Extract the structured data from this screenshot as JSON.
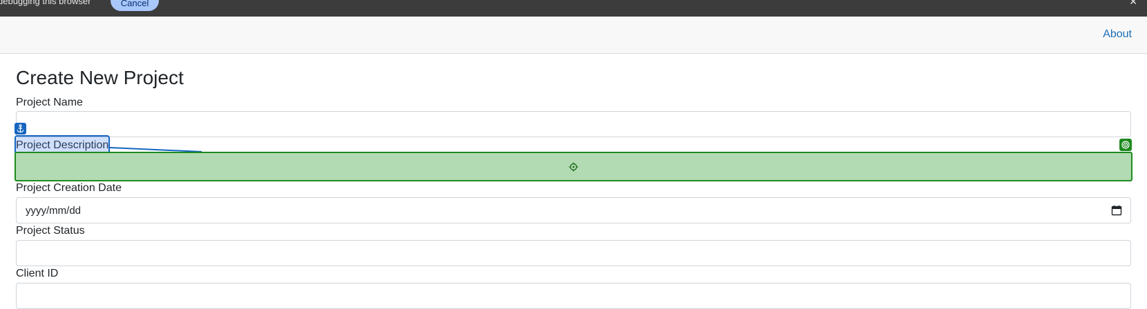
{
  "infobar": {
    "message": "debugging this browser",
    "cancel_label": "Cancel",
    "close_glyph": "✕"
  },
  "navbar": {
    "about_label": "About"
  },
  "form": {
    "title": "Create New Project",
    "fields": [
      {
        "label": "Project Name",
        "value": ""
      },
      {
        "label": "Project Description",
        "value": ""
      },
      {
        "label": "Project Creation Date",
        "placeholder": "yyyy/mm/dd"
      },
      {
        "label": "Project Status",
        "value": ""
      },
      {
        "label": "Client ID",
        "value": ""
      }
    ]
  },
  "overlay": {
    "anchor_icon": "anchor-icon",
    "target_icon": "target-icon",
    "crosshair_icon": "crosshair-icon",
    "highlight_color": "#1565c0",
    "drop_color": "#1e8a1e",
    "drop_fill": "#b3dbb3"
  },
  "colors": {
    "link": "#1a6fb5",
    "infobar_bg": "#3c3c3c",
    "cancel_bg": "#a8c7fa"
  }
}
